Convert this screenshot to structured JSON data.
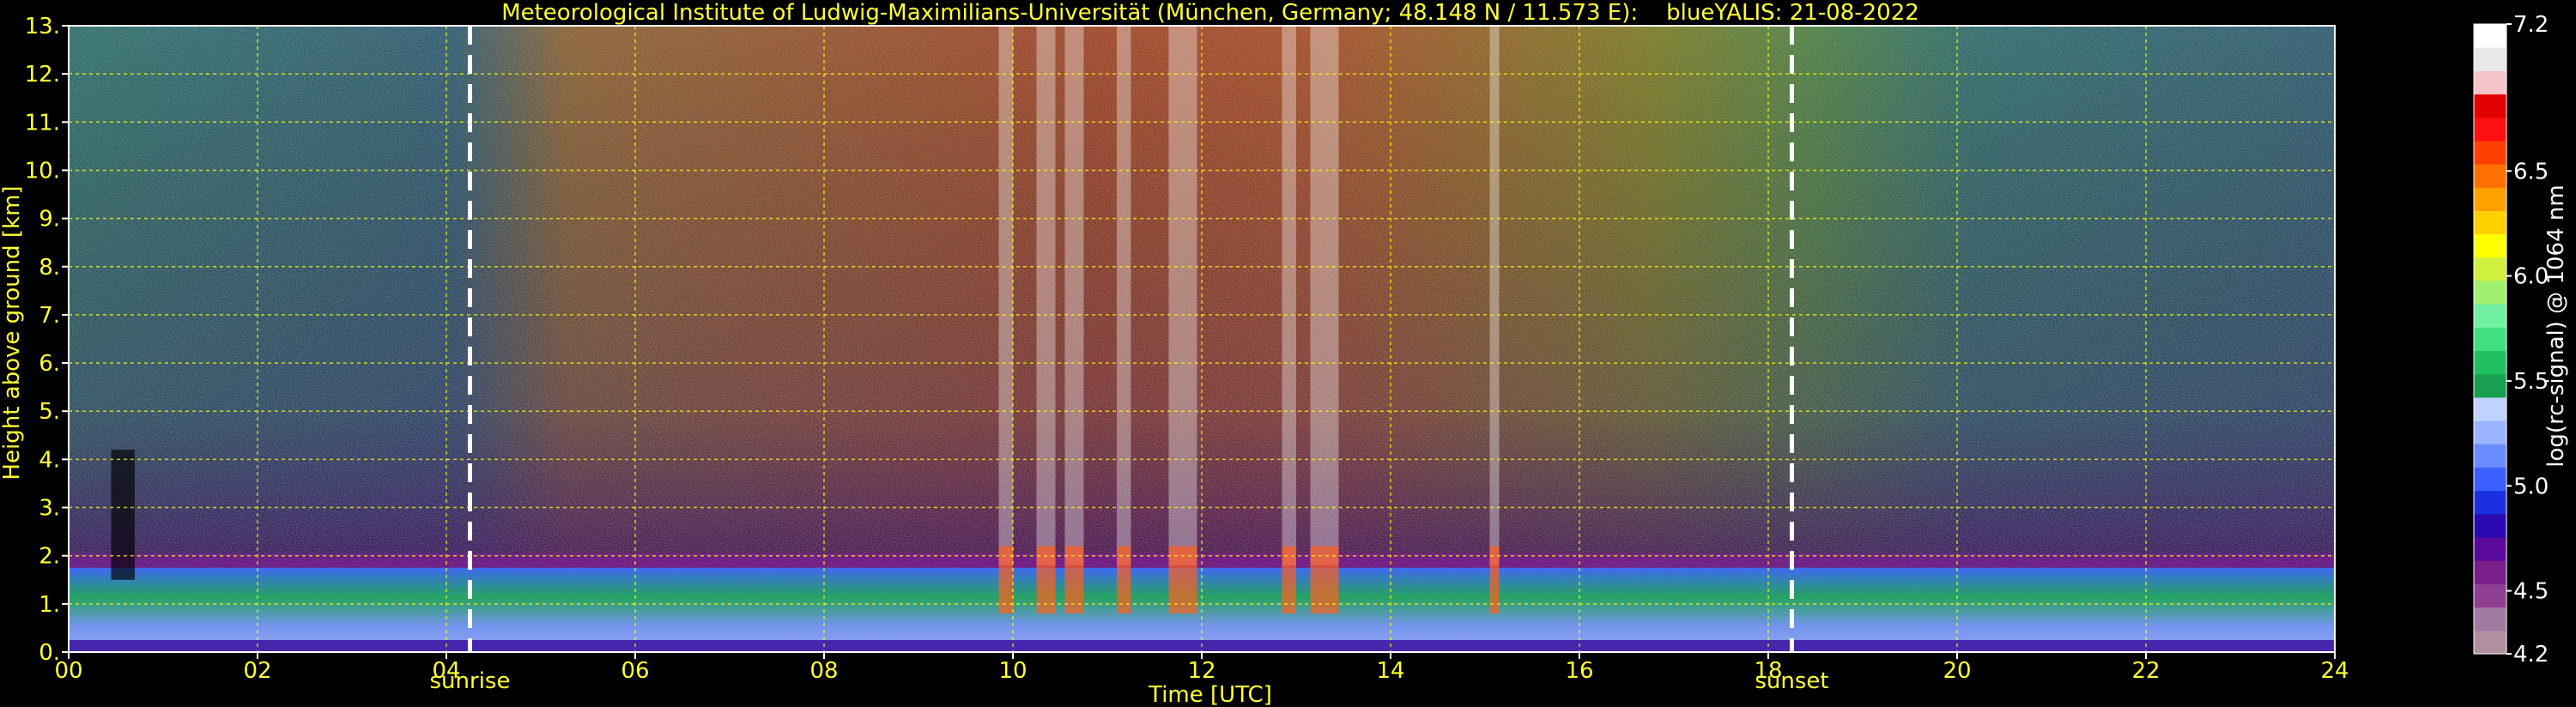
{
  "chart_data": {
    "type": "heatmap",
    "title": "Meteorological Institute of Ludwig-Maximilians-Universität (München, Germany; 48.148 N / 11.573 E):    blueYALIS: 21-08-2022",
    "xlabel": "Time [UTC]",
    "ylabel": "Height above ground [km]",
    "x_range": [
      0,
      24
    ],
    "y_range": [
      0,
      13
    ],
    "x_ticks": [
      {
        "value": 0,
        "label": "00"
      },
      {
        "value": 2,
        "label": "02"
      },
      {
        "value": 4,
        "label": "04"
      },
      {
        "value": 6,
        "label": "06"
      },
      {
        "value": 8,
        "label": "08"
      },
      {
        "value": 10,
        "label": "10"
      },
      {
        "value": 12,
        "label": "12"
      },
      {
        "value": 14,
        "label": "14"
      },
      {
        "value": 16,
        "label": "16"
      },
      {
        "value": 18,
        "label": "18"
      },
      {
        "value": 20,
        "label": "20"
      },
      {
        "value": 22,
        "label": "22"
      },
      {
        "value": 24,
        "label": "24"
      }
    ],
    "y_ticks": [
      {
        "value": 0,
        "label": "0."
      },
      {
        "value": 1,
        "label": "1."
      },
      {
        "value": 2,
        "label": "2."
      },
      {
        "value": 3,
        "label": "3."
      },
      {
        "value": 4,
        "label": "4."
      },
      {
        "value": 5,
        "label": "5."
      },
      {
        "value": 6,
        "label": "6."
      },
      {
        "value": 7,
        "label": "7."
      },
      {
        "value": 8,
        "label": "8."
      },
      {
        "value": 9,
        "label": "9."
      },
      {
        "value": 10,
        "label": "10."
      },
      {
        "value": 11,
        "label": "11."
      },
      {
        "value": 12,
        "label": "12."
      },
      {
        "value": 13,
        "label": "13."
      }
    ],
    "grid": true,
    "markers": [
      {
        "x": 4.25,
        "label": "sunrise"
      },
      {
        "x": 18.25,
        "label": "sunset"
      }
    ],
    "colorbar": {
      "label": "log(rc-signal) @ 1064 nm",
      "range": [
        4.2,
        7.2
      ],
      "tick_labels": [
        {
          "value": 4.2,
          "label": "4.2"
        },
        {
          "value": 4.5,
          "label": "4.5"
        },
        {
          "value": 5.0,
          "label": "5.0"
        },
        {
          "value": 5.5,
          "label": "5.5"
        },
        {
          "value": 6.0,
          "label": "6.0"
        },
        {
          "value": 6.5,
          "label": "6.5"
        },
        {
          "value": 7.2,
          "label": "7.2"
        }
      ],
      "colors": [
        "#b090a0",
        "#a07aa0",
        "#8f3f92",
        "#7a1f8a",
        "#5a0a9a",
        "#2a0ab0",
        "#1a30e0",
        "#3a60ff",
        "#6a8aff",
        "#9ab4ff",
        "#c0d2ff",
        "#18a050",
        "#20c060",
        "#40e080",
        "#70f0a0",
        "#a0f070",
        "#d0f040",
        "#ffff00",
        "#ffd000",
        "#ffa000",
        "#ff7000",
        "#ff4000",
        "#ff1010",
        "#e00000",
        "#f4c4c8",
        "#e8e8e8",
        "#ffffff"
      ]
    }
  }
}
